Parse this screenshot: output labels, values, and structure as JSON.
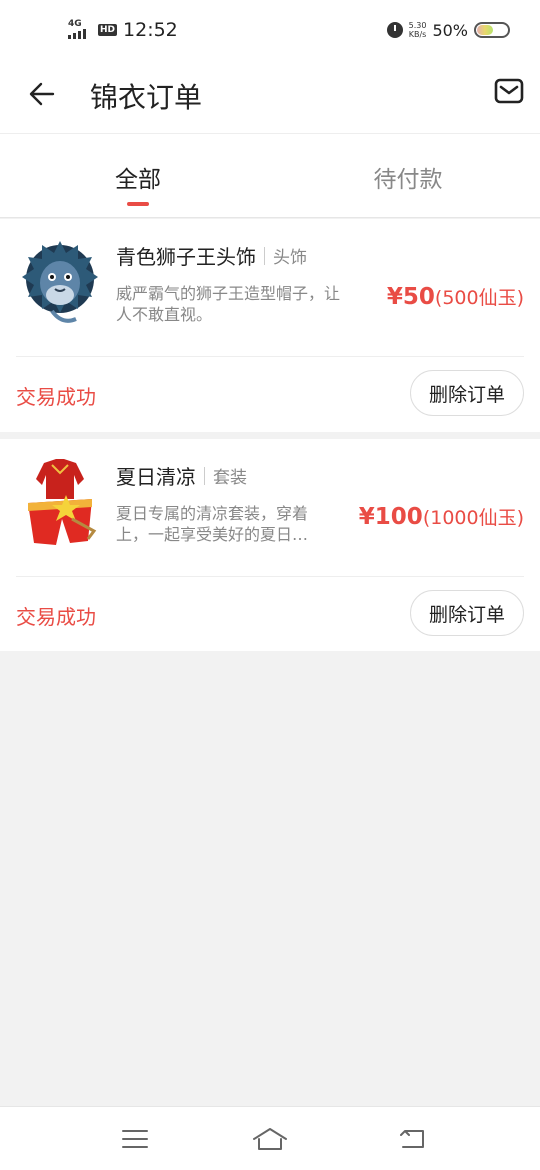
{
  "status_bar": {
    "network": "4G",
    "hd": "HD",
    "time": "12:52",
    "speed_value": "5.30",
    "speed_unit": "KB/s",
    "battery": "50%"
  },
  "header": {
    "title": "锦衣订单",
    "back_icon": "back-arrow-icon",
    "mail_icon": "mail-icon"
  },
  "tabs": [
    {
      "label": "全部",
      "active": true
    },
    {
      "label": "待付款",
      "active": false
    }
  ],
  "orders": [
    {
      "name": "青色狮子王头饰",
      "category": "头饰",
      "description": "威严霸气的狮子王造型帽子，让人不敢直视。",
      "price_yen": "¥50",
      "price_jade": "(500仙玉)",
      "status": "交易成功",
      "action": "删除订单"
    },
    {
      "name": "夏日清凉",
      "category": "套装",
      "description_line1": "夏日专属的清凉套装，穿着",
      "description_line2": "上，一起享受美好的夏日…",
      "price_yen": "¥100",
      "price_jade": "(1000仙玉)",
      "status": "交易成功",
      "action": "删除订单"
    }
  ],
  "nav_bar": {
    "menu_icon": "menu-icon",
    "home_icon": "home-icon",
    "back_icon": "return-icon"
  },
  "colors": {
    "accent": "#e94c45",
    "background": "#f2f2f2"
  }
}
